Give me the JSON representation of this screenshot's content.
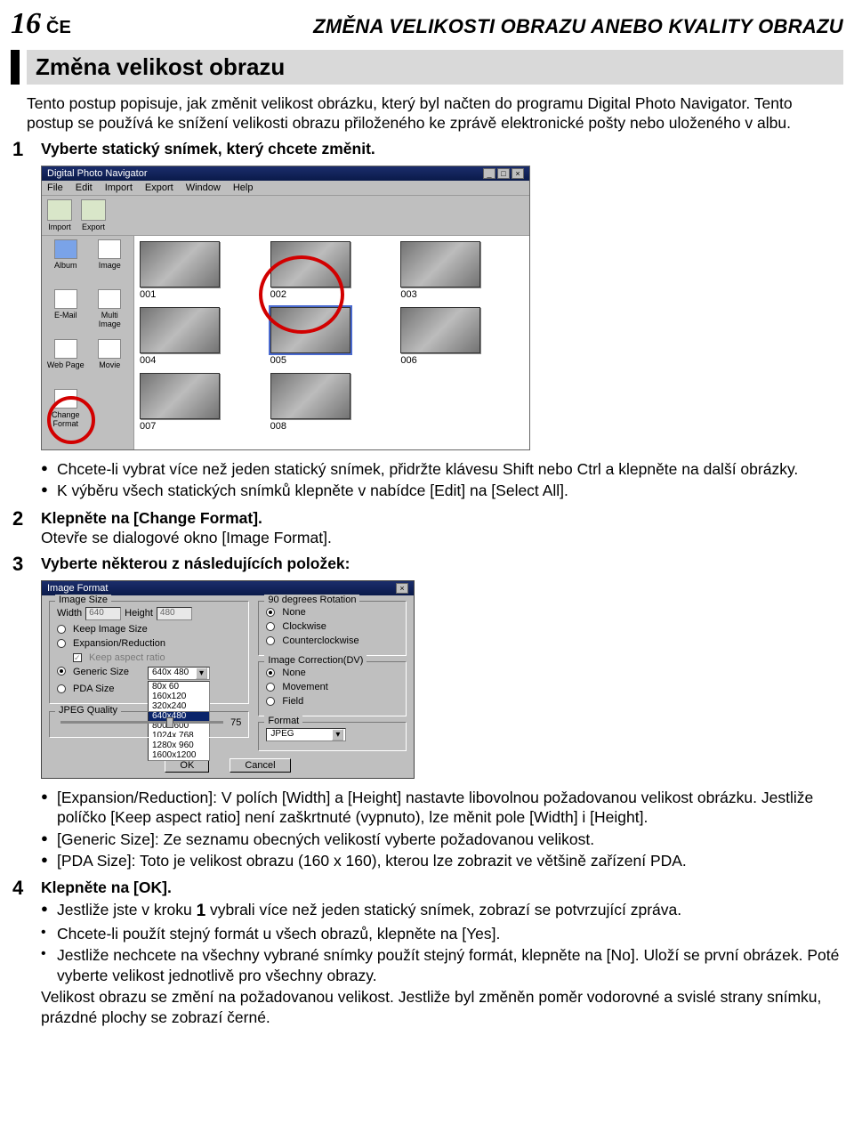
{
  "page_number": "16",
  "lang_code": "ČE",
  "chapter_title": "ZMĚNA VELIKOSTI OBRAZU ANEBO KVALITY OBRAZU",
  "section_title": "Změna velikost obrazu",
  "intro": "Tento postup popisuje, jak změnit velikost obrázku, který byl načten do programu Digital Photo Navigator. Tento postup se používá ke snížení velikosti obrazu přiloženého ke zprávě elektronické pošty nebo uloženého v albu.",
  "steps": {
    "1": {
      "num": "1",
      "title": "Vyberte statický snímek, který chcete změnit."
    },
    "1_bullets": [
      "Chcete-li vybrat více než jeden statický snímek, přidržte klávesu Shift nebo Ctrl a klepněte na další obrázky.",
      "K výběru všech statických snímků klepněte v nabídce [Edit] na [Select All]."
    ],
    "2": {
      "num": "2",
      "title": "Klepněte na [Change Format].",
      "sub": "Otevře se dialogové okno [Image Format]."
    },
    "3": {
      "num": "3",
      "title": "Vyberte některou z následujících položek:"
    },
    "3_bullets": [
      "[Expansion/Reduction]: V polích [Width] a [Height] nastavte libovolnou požadovanou velikost obrázku. Jestliže políčko [Keep aspect ratio] není zaškrtnuté (vypnuto), lze měnit pole [Width] i [Height].",
      "[Generic Size]: Ze seznamu obecných velikostí vyberte požadovanou velikost.",
      "[PDA Size]: Toto je velikost obrazu (160 x 160), kterou lze zobrazit ve většině zařízení PDA."
    ],
    "4": {
      "num": "4",
      "title": "Klepněte na [OK]."
    },
    "4_bullets_pre": "Jestliže jste v kroku ",
    "4_bullets_step": "1",
    "4_bullets_post": " vybrali více než jeden statický snímek, zobrazí se potvrzující zpráva.",
    "4_sub_bullets": [
      "Chcete-li použít stejný formát u všech obrazů, klepněte na [Yes].",
      "Jestliže nechcete na všechny vybrané snímky použít stejný formát, klepněte na [No]. Uloží se první obrázek. Poté vyberte velikost jednotlivě pro všechny obrazy."
    ],
    "4_tail": "Velikost obrazu se změní na požadovanou velikost. Jestliže byl změněn poměr vodorovné a svislé strany snímku, prázdné plochy se zobrazí černé."
  },
  "appwin": {
    "title": "Digital Photo Navigator",
    "menus": [
      "File",
      "Edit",
      "Import",
      "Export",
      "Window",
      "Help"
    ],
    "toolbar": [
      {
        "label": "Import"
      },
      {
        "label": "Export"
      }
    ],
    "sidebar": [
      "Album",
      "Image",
      "E-Mail",
      "Multi Image",
      "Web Page",
      "Movie",
      "Change Format",
      ""
    ],
    "thumbs": [
      "001",
      "002",
      "003",
      "004",
      "005",
      "006",
      "007",
      "008"
    ]
  },
  "dialog": {
    "title": "Image Format",
    "grp_size": "Image Size",
    "width_lbl": "Width",
    "width_val": "640",
    "height_lbl": "Height",
    "height_val": "480",
    "keep_lbl": "Keep Image Size",
    "exp_lbl": "Expansion/Reduction",
    "aspect_lbl": "Keep aspect ratio",
    "generic_lbl": "Generic Size",
    "pda_lbl": "PDA Size",
    "sizes": [
      "640x 480",
      "80x 60",
      "160x120",
      "320x240",
      "640x480",
      "800x 600",
      "1024x 768",
      "1280x 960",
      "1600x1200"
    ],
    "grp_quality": "JPEG Quality",
    "quality_val": "75",
    "grp_rot": "90 degrees Rotation",
    "rot_none": "None",
    "rot_cw": "Clockwise",
    "rot_ccw": "Counterclockwise",
    "grp_ic": "Image Correction(DV)",
    "ic_none": "None",
    "ic_mov": "Movement",
    "ic_field": "Field",
    "grp_fmt": "Format",
    "fmt_val": "JPEG",
    "btn_ok": "OK",
    "btn_cancel": "Cancel"
  }
}
